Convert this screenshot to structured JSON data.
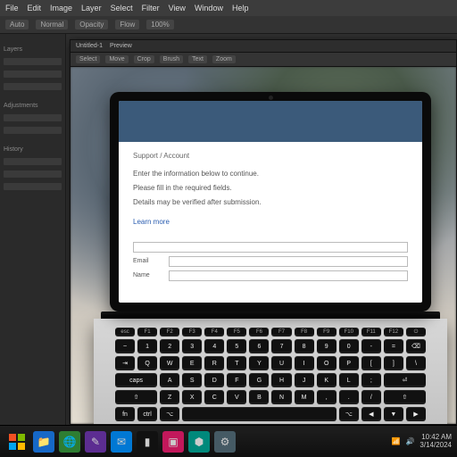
{
  "menubar": {
    "items": [
      "File",
      "Edit",
      "Image",
      "Layer",
      "Select",
      "Filter",
      "View",
      "Window",
      "Help"
    ]
  },
  "toolrow": {
    "items": [
      "Auto",
      "Normal",
      "Opacity",
      "Flow",
      "100%"
    ]
  },
  "left_panel": {
    "section1": "Layers",
    "section2": "Adjustments",
    "section3": "History"
  },
  "inner_window": {
    "tabs": [
      "Untitled-1",
      "Preview"
    ],
    "toolbar": [
      "Select",
      "Move",
      "Crop",
      "Brush",
      "Text",
      "Zoom"
    ]
  },
  "laptop_screen": {
    "breadcrumb": "Support / Account",
    "lines": [
      "Enter the information below to continue.",
      "Please fill in the required fields.",
      "Details may be verified after submission."
    ],
    "link": "Learn more",
    "form": {
      "label1": "Email",
      "label2": "Name"
    }
  },
  "taskbar": {
    "apps": [
      "explorer",
      "browser",
      "editor",
      "mail",
      "terminal",
      "photos",
      "store",
      "settings"
    ],
    "tray": {
      "time": "10:42 AM",
      "date": "3/14/2024"
    }
  },
  "colors": {
    "screen_header": "#3b5a7a"
  }
}
